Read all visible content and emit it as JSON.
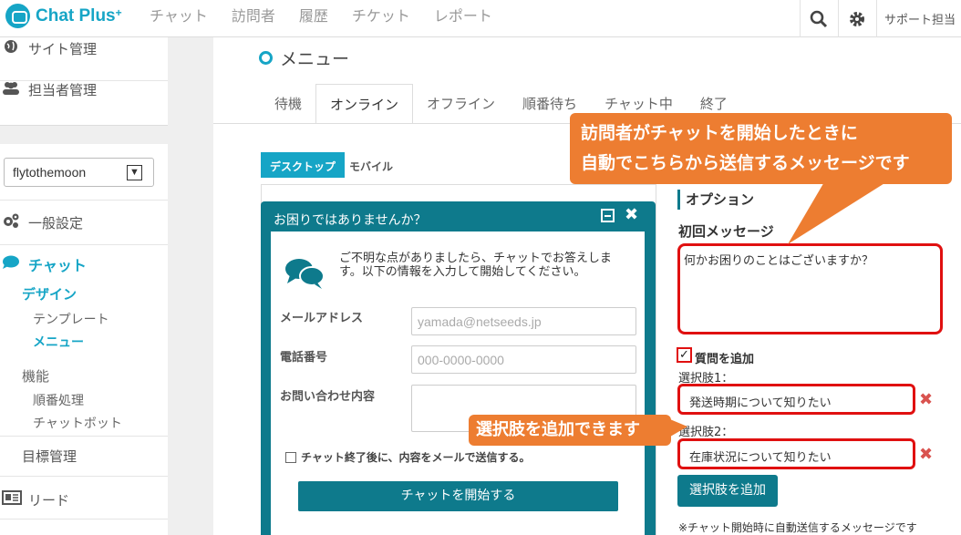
{
  "header": {
    "logo_text": "Chat Plus",
    "logo_plus": "+",
    "nav": [
      "チャット",
      "訪問者",
      "履歴",
      "チケット",
      "レポート"
    ],
    "user_label": "サポート担当"
  },
  "sidebar": {
    "site_admin": "サイト管理",
    "staff_admin": "担当者管理",
    "site_select": "flytothemoon",
    "general_settings": "一般設定",
    "chat": "チャット",
    "design": "デザイン",
    "template": "テンプレート",
    "menu": "メニュー",
    "features": "機能",
    "queue": "順番処理",
    "chatbot": "チャットボット",
    "goals": "目標管理",
    "leads": "リード"
  },
  "page": {
    "title": "メニュー",
    "tabs": [
      "待機",
      "オンライン",
      "オフライン",
      "順番待ち",
      "チャット中",
      "終了"
    ],
    "active_tab": "オンライン",
    "device_desktop": "デスクトップ",
    "device_mobile": "モバイル"
  },
  "widget": {
    "header": "お困りではありませんか？",
    "intro": "ご不明な点がありましたら、チャットでお答えします。以下の情報を入力して開始してください。",
    "email_label": "メールアドレス",
    "email_placeholder": "yamada@netseeds.jp",
    "phone_label": "電話番号",
    "phone_placeholder": "000-0000-0000",
    "inquiry_label": "お問い合わせ内容",
    "send_copy": "チャット終了後に、内容をメールで送信する。",
    "start_button": "チャットを開始する"
  },
  "options": {
    "title": "オプション",
    "first_message_label": "初回メッセージ",
    "first_message": "何かお困りのことはございますか？",
    "add_question_label": "質問を追加",
    "choice1_label": "選択肢1：",
    "choice1_value": "発送時期について知りたい",
    "choice2_label": "選択肢2：",
    "choice2_value": "在庫状況について知りたい",
    "add_choice_button": "選択肢を追加",
    "note": "※チャット開始時に自動送信するメッセージです"
  },
  "callouts": {
    "top_line1": "訪問者がチャットを開始したときに",
    "top_line2": "自動でこちらから送信するメッセージです",
    "bottom": "選択肢を追加できます"
  },
  "colors": {
    "brand": "#16a5c6",
    "teal": "#0e7a8c",
    "callout": "#ed7d31",
    "highlight": "#e01010"
  }
}
